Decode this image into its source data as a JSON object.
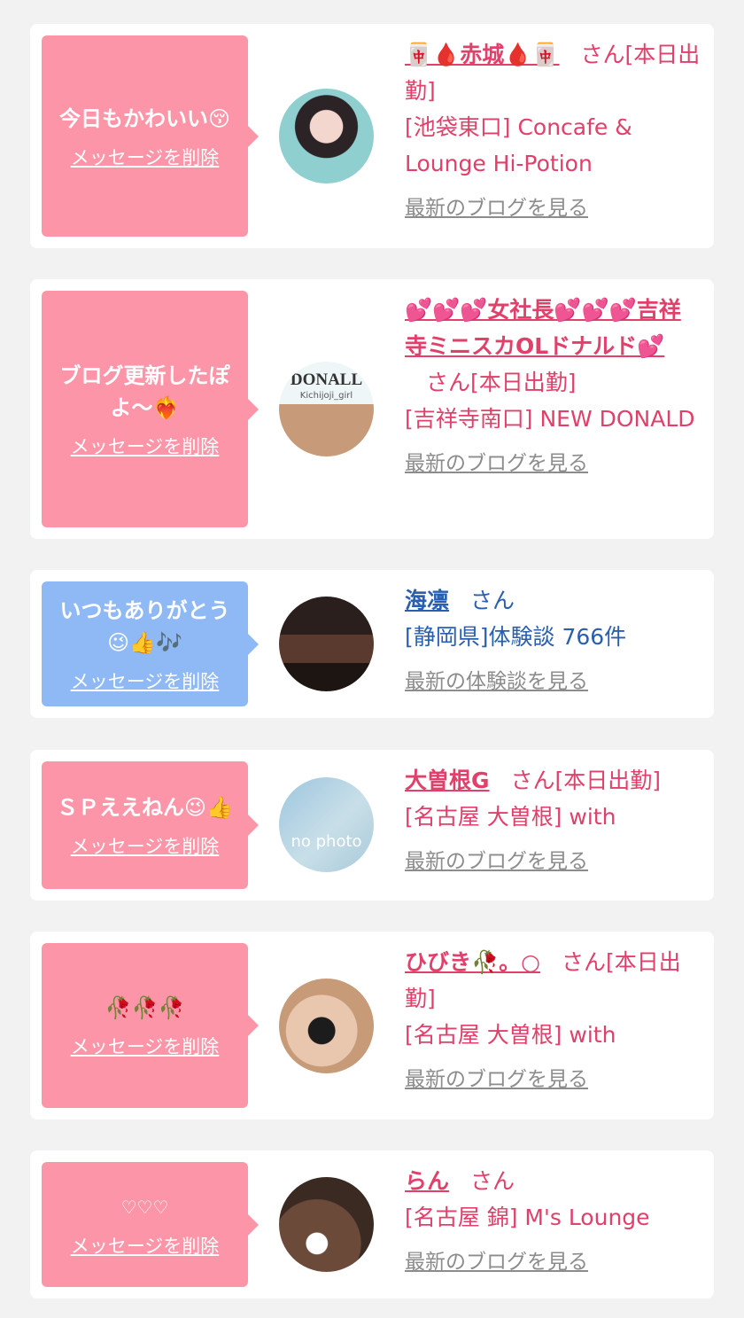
{
  "items": [
    {
      "message": "今日もかわいい😚",
      "delete_label": "メッセージを削除",
      "name": "🀄🩸赤城🩸🀄",
      "honorific": "さん",
      "status": "[本日出勤]",
      "shop": "[池袋東口] Concafe & Lounge Hi-Potion",
      "more_label": "最新のブログを見る"
    },
    {
      "message": "ブログ更新したぽよ〜❤️‍🔥",
      "delete_label": "メッセージを削除",
      "name": "💕💕💕女社長💕💕💕吉祥寺ミニスカOLドナルド💕",
      "honorific": "さん",
      "status": "[本日出勤]",
      "shop": "[吉祥寺南口] NEW DONALD",
      "more_label": "最新のブログを見る",
      "avatar_text": "DONALL",
      "avatar_subtext": "Kichijoji_girl"
    },
    {
      "message": "いつもありがとう😉👍🎶",
      "delete_label": "メッセージを削除",
      "name": "海凛",
      "honorific": "さん",
      "status": "",
      "shop": "[静岡県]体験談 766件",
      "more_label": "最新の体験談を見る"
    },
    {
      "message": "ＳＰええねん😉👍",
      "delete_label": "メッセージを削除",
      "name": "大曽根G",
      "honorific": "さん",
      "status": "[本日出勤]",
      "shop": "[名古屋 大曽根] with",
      "more_label": "最新のブログを見る",
      "avatar_text": "no photo"
    },
    {
      "message": "🥀🥀🥀",
      "delete_label": "メッセージを削除",
      "name": "ひびき🥀。○",
      "honorific": "さん",
      "status": "[本日出勤]",
      "shop": "[名古屋 大曽根] with",
      "more_label": "最新のブログを見る"
    },
    {
      "message": "♡♡♡",
      "delete_label": "メッセージを削除",
      "name": "らん",
      "honorific": "さん",
      "status": "",
      "shop": "[名古屋 錦] M's Lounge",
      "more_label": "最新のブログを見る"
    }
  ],
  "colors": {
    "page_bg": "#f2f2f2",
    "bubble_pink": "#fd95a8",
    "bubble_blue": "#8fb9f5",
    "text_pink": "#e0406a",
    "text_blue": "#2a5fb0",
    "link_gray": "#8c8c8c"
  }
}
